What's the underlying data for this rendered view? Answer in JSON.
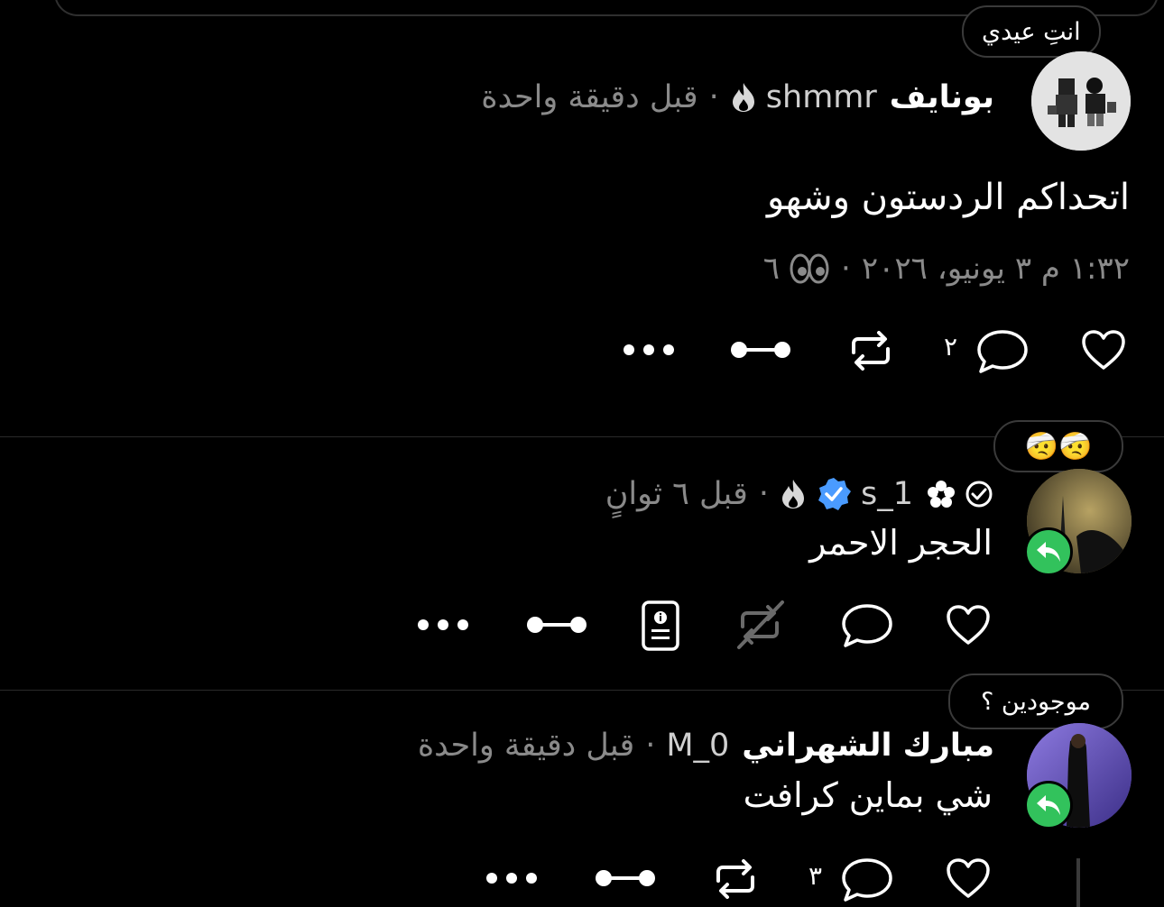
{
  "note1": "انتِ عيدي",
  "post1": {
    "name": "بونايف",
    "handle": "shmmr",
    "sep": "·",
    "time": "قبل دقيقة واحدة",
    "text": "اتحداكم الردستون وشهو",
    "datetime": "١:٣٢ م ٣ يونيو، ٢٠٢٦",
    "views": "٦",
    "reply_count": "٢"
  },
  "reaction_emojis": "🤕🤕",
  "post2": {
    "handle": "1_s",
    "sep": "·",
    "time": "قبل ٦ ثوانٍ",
    "text": "الحجر الاحمر"
  },
  "note3": "موجودين ؟",
  "post3": {
    "name": "مبارك الشهراني",
    "handle": "M_0",
    "sep": "·",
    "time": "قبل دقيقة واحدة",
    "text": "شي بماين كرافت",
    "reply_count": "٣"
  },
  "colors": {
    "verified": "#4a9bff",
    "reply_badge": "#32c25c"
  },
  "icons": [
    "heart-icon",
    "comment-icon",
    "repost-icon",
    "timeline-icon",
    "more-icon",
    "flame-icon",
    "verified-icon",
    "check-circle-icon",
    "flower-icon",
    "eyes-icon",
    "report-card-icon",
    "repost-disabled-icon",
    "reply-arrow-icon"
  ]
}
